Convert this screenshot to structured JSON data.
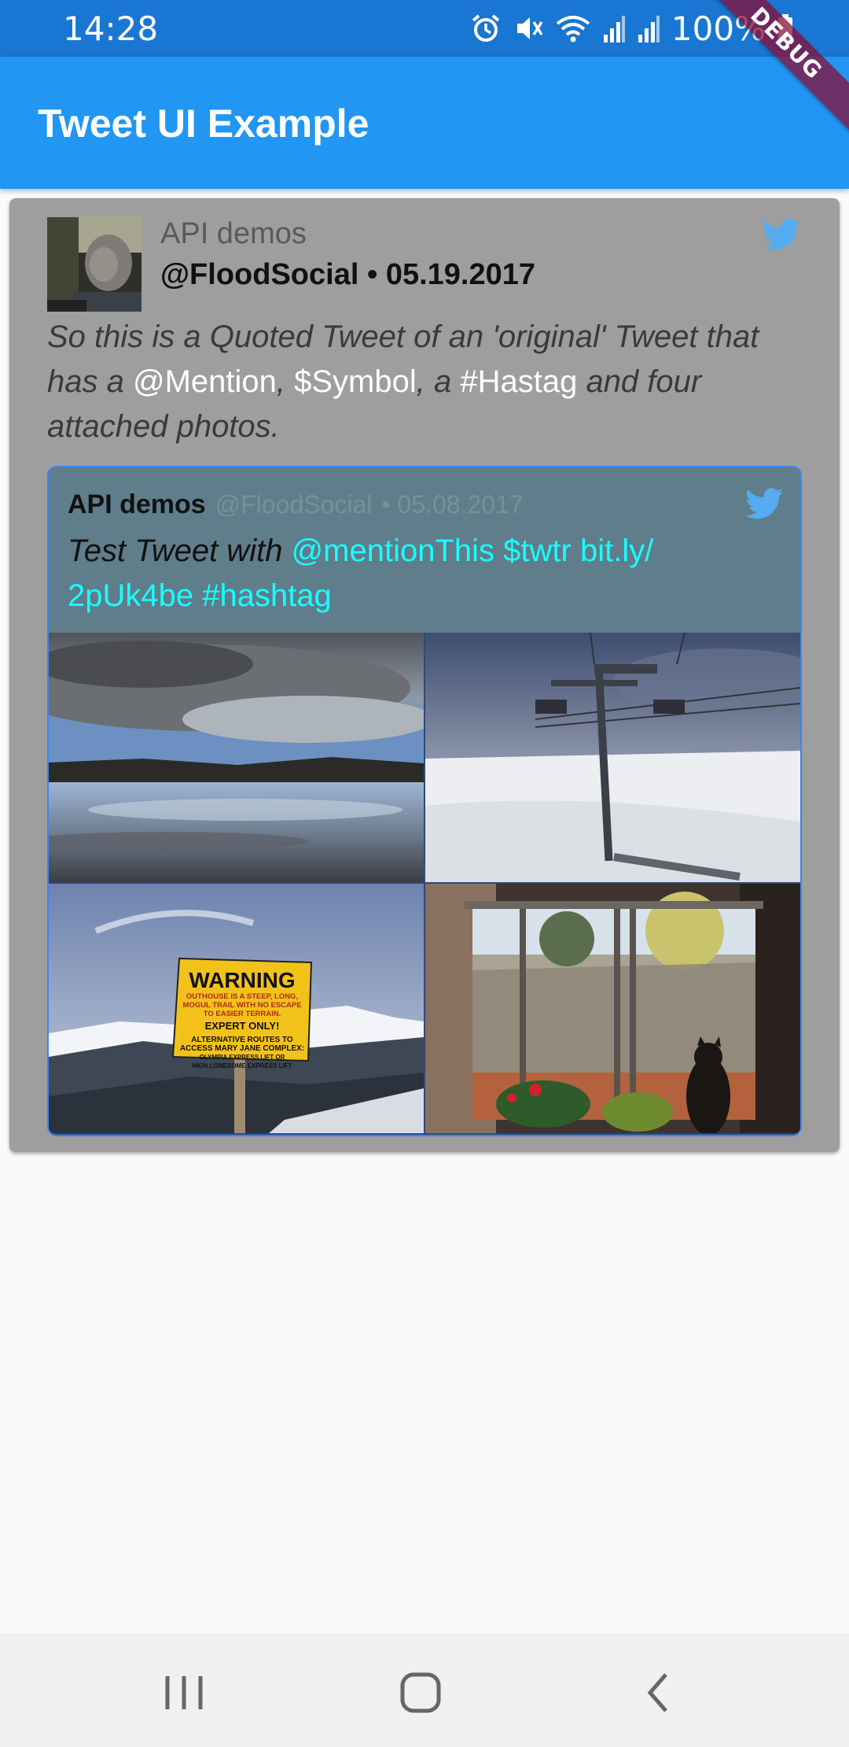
{
  "status_bar": {
    "time": "14:28",
    "battery": "100%",
    "icons": [
      "alarm-icon",
      "mute-icon",
      "wifi-icon",
      "signal-icon",
      "signal-icon",
      "battery-icon"
    ]
  },
  "debug_banner": "DEBUG",
  "app_bar": {
    "title": "Tweet UI Example"
  },
  "tweet": {
    "user_name": "API demos",
    "handle_date": "@FloodSocial • 05.19.2017",
    "text": {
      "t1": "So this is a Quoted Tweet of an 'original' Tweet that has a ",
      "mention": "@Mention",
      "t2": ",  ",
      "symbol": "$Symbol",
      "t3": ", a ",
      "hashtag": "#Hastag",
      "t4": " and four attached photos."
    },
    "quoted": {
      "user_name": "API demos",
      "handle": "@FloodSocial",
      "date": "• 05.08.2017",
      "text": {
        "t1": "Test Tweet with ",
        "mention": "@mentionThis",
        "symbol": "$twtr",
        "url": "bit.ly/​2pUk4be",
        "hashtag": "#hashtag"
      },
      "photos": [
        "lake-photo",
        "ski-lift-photo",
        "warning-sign-photo",
        "window-cat-photo"
      ],
      "warning_sign": {
        "title": "WARNING",
        "lines": [
          "OUTHOUSE IS A STEEP, LONG,",
          "MOGUL TRAIL WITH NO ESCAPE",
          "TO EASIER TERRAIN.",
          "EXPERT ONLY!",
          "ALTERNATIVE ROUTES TO",
          "ACCESS MARY JANE COMPLEX:",
          "OLYMPIA EXPRESS LIFT OR",
          "HIGH LONESOME EXPRESS LIFT"
        ]
      }
    }
  },
  "colors": {
    "status_bar": "#1976d2",
    "app_bar": "#2196f3",
    "card": "#9e9e9e",
    "quote_bg": "#607d8b",
    "quote_border": "#3d84f0",
    "quoted_entity": "#18ffff",
    "twitter_blue": "#55acee"
  },
  "nav_bar": {
    "buttons": [
      "recent-apps-button",
      "home-button",
      "back-button"
    ]
  }
}
